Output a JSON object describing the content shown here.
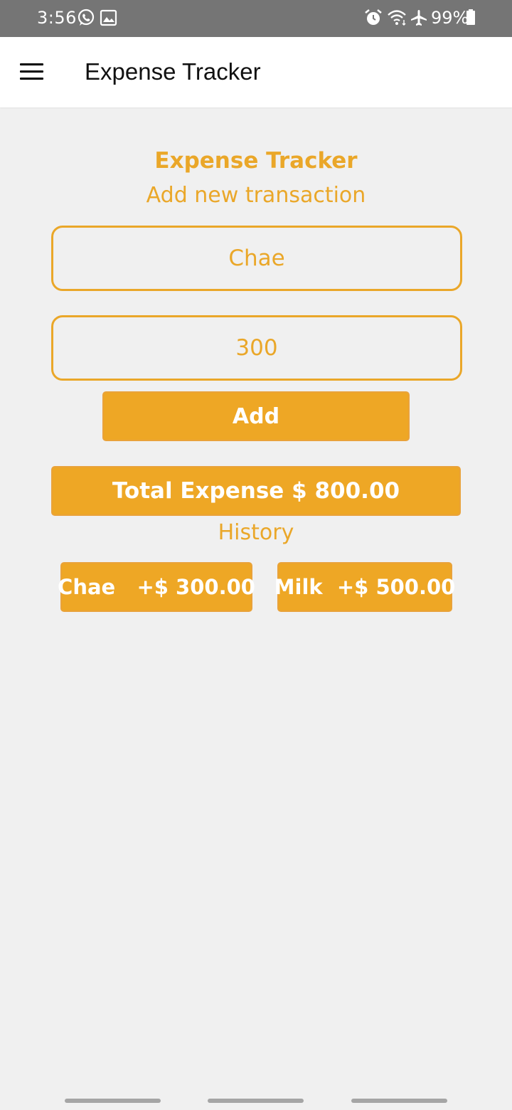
{
  "status_bar": {
    "time": "3:56",
    "battery": "99%",
    "left_icons": [
      "whatsapp-icon",
      "image-icon"
    ],
    "right_icons": [
      "alarm-icon",
      "wifi-icon",
      "airplane-icon",
      "battery-icon"
    ]
  },
  "app_bar": {
    "title": "Expense Tracker",
    "menu_icon": "hamburger-menu-icon"
  },
  "main": {
    "heading": "Expense Tracker",
    "subheading": "Add new transaction",
    "name_field_value": "Chae",
    "amount_field_value": "300",
    "add_label": "Add",
    "total_label": "Total Expense $ 800.00",
    "history_label": "History",
    "history": [
      {
        "label": "Chae   +$ 300.00"
      },
      {
        "label": "Milk  +$ 500.00"
      }
    ]
  },
  "colors": {
    "accent": "#eea725",
    "accent_text": "#eaa729",
    "status_bar": "#757575",
    "background": "#f0f0f0"
  }
}
